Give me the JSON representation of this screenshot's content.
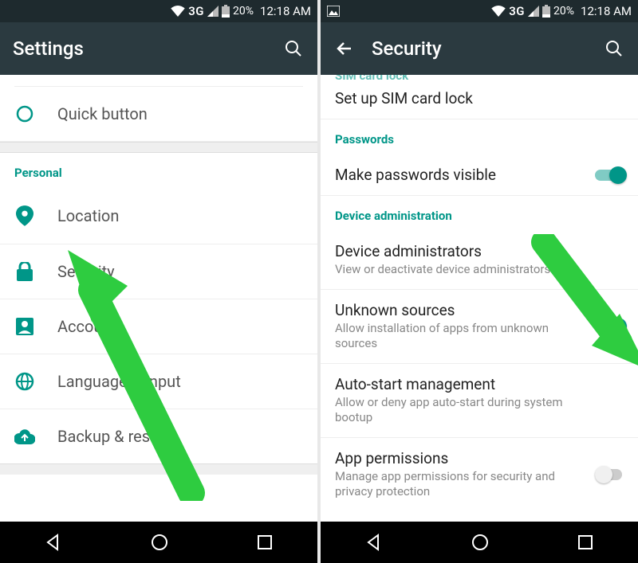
{
  "status": {
    "network": "3G",
    "battery_pct": "20%",
    "time": "12:18 AM"
  },
  "left": {
    "title": "Settings",
    "items": {
      "quick": "Quick button",
      "section": "Personal",
      "location": "Location",
      "security": "Security",
      "accounts": "Accounts",
      "language": "Language & input",
      "backup": "Backup & reset"
    }
  },
  "right": {
    "title": "Security",
    "sim_partial": "SIM card lock",
    "sim_setup": "Set up SIM card lock",
    "passwords_header": "Passwords",
    "pw_visible": "Make passwords visible",
    "device_admin_header": "Device administration",
    "device_admins": {
      "title": "Device administrators",
      "sub": "View or deactivate device administrators"
    },
    "unknown": {
      "title": "Unknown sources",
      "sub": "Allow installation of apps from unknown sources"
    },
    "autostart": {
      "title": "Auto-start management",
      "sub": "Allow or deny app auto-start during system bootup"
    },
    "app_perms": {
      "title": "App permissions",
      "sub": "Manage app permissions for security and privacy protection"
    }
  }
}
